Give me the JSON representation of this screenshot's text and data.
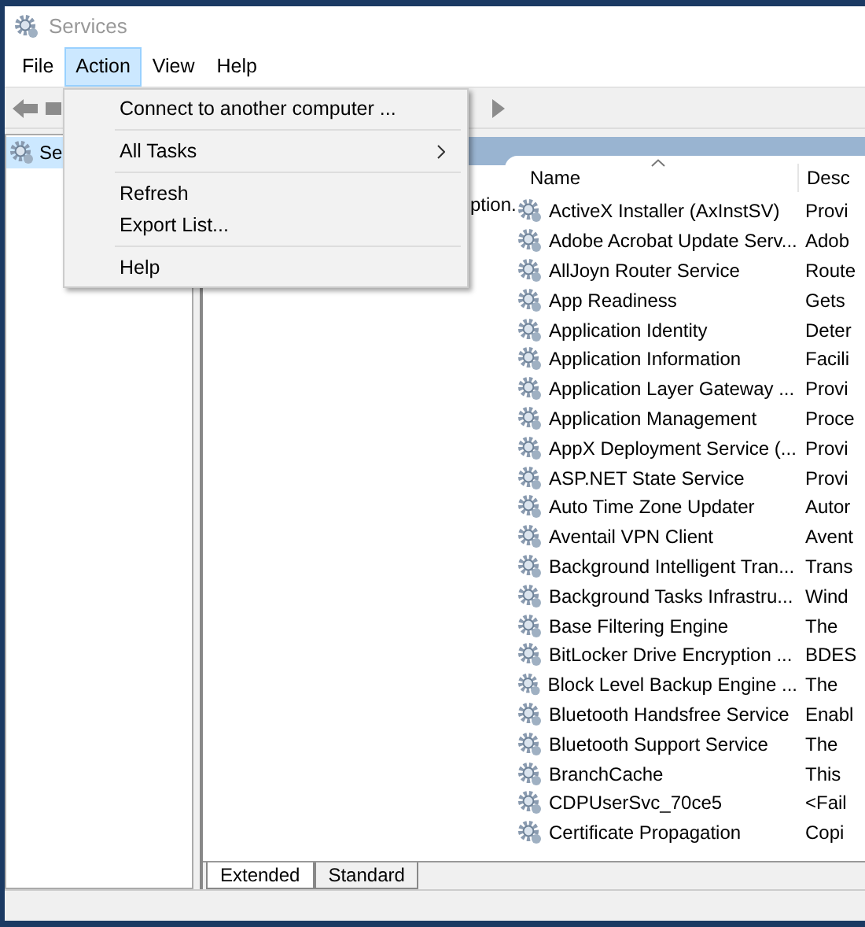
{
  "window": {
    "title": "Services"
  },
  "menu_bar": [
    {
      "label": "File",
      "selected": false
    },
    {
      "label": "Action",
      "selected": true
    },
    {
      "label": "View",
      "selected": false
    },
    {
      "label": "Help",
      "selected": false
    }
  ],
  "action_menu": [
    {
      "kind": "item",
      "label": "Connect to another computer ..."
    },
    {
      "kind": "separator"
    },
    {
      "kind": "submenu",
      "label": "All Tasks"
    },
    {
      "kind": "separator"
    },
    {
      "kind": "item",
      "label": "Refresh"
    },
    {
      "kind": "item",
      "label": "Export List..."
    },
    {
      "kind": "separator"
    },
    {
      "kind": "item",
      "label": "Help"
    }
  ],
  "tree": {
    "items": [
      {
        "label": "Se",
        "selected": true
      }
    ]
  },
  "description_pane": {
    "text": "ption."
  },
  "list": {
    "columns": [
      "Name",
      "Desc"
    ],
    "rows": [
      {
        "name": "ActiveX Installer (AxInstSV)",
        "description": "Provi"
      },
      {
        "name": "Adobe Acrobat Update Serv...",
        "description": "Adob"
      },
      {
        "name": "AllJoyn Router Service",
        "description": "Route"
      },
      {
        "name": "App Readiness",
        "description": "Gets"
      },
      {
        "name": "Application Identity",
        "description": "Deter"
      },
      {
        "name": "Application Information",
        "description": "Facili"
      },
      {
        "name": "Application Layer Gateway ...",
        "description": "Provi"
      },
      {
        "name": "Application Management",
        "description": "Proce"
      },
      {
        "name": "AppX Deployment Service (...",
        "description": "Provi"
      },
      {
        "name": "ASP.NET State Service",
        "description": "Provi"
      },
      {
        "name": "Auto Time Zone Updater",
        "description": "Autor"
      },
      {
        "name": "Aventail VPN Client",
        "description": "Avent"
      },
      {
        "name": "Background Intelligent Tran...",
        "description": "Trans"
      },
      {
        "name": "Background Tasks Infrastru...",
        "description": "Wind"
      },
      {
        "name": "Base Filtering Engine",
        "description": "The"
      },
      {
        "name": "BitLocker Drive Encryption ...",
        "description": "BDES"
      },
      {
        "name": "Block Level Backup Engine ...",
        "description": "The"
      },
      {
        "name": "Bluetooth Handsfree Service",
        "description": "Enabl"
      },
      {
        "name": "Bluetooth Support Service",
        "description": "The"
      },
      {
        "name": "BranchCache",
        "description": "This"
      },
      {
        "name": "CDPUserSvc_70ce5",
        "description": "<Fail"
      },
      {
        "name": "Certificate Propagation",
        "description": "Copi"
      }
    ]
  },
  "view_tabs": [
    {
      "label": "Extended",
      "selected": true
    },
    {
      "label": "Standard",
      "selected": false
    }
  ]
}
